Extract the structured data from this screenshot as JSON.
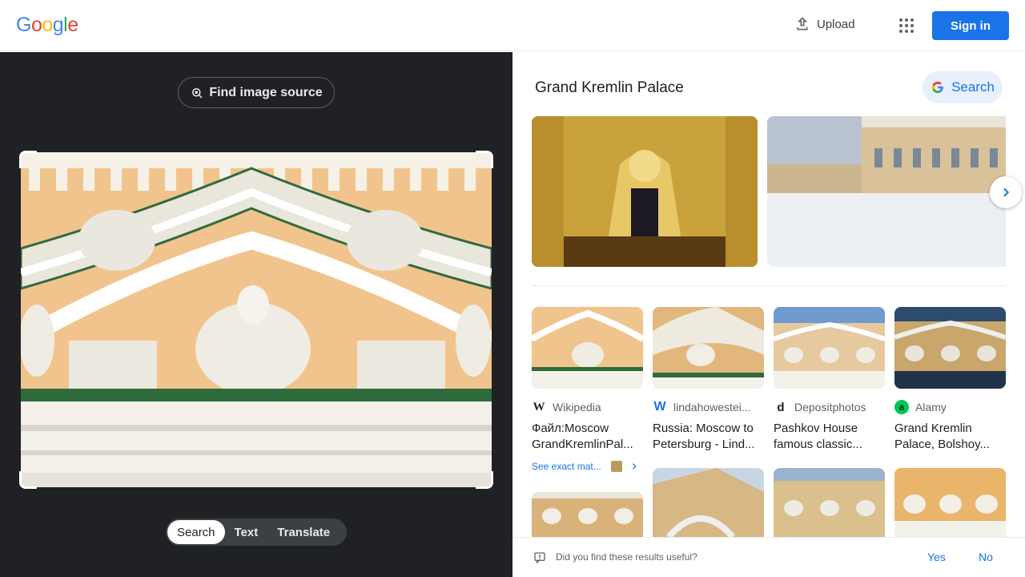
{
  "header": {
    "logo_letters": [
      {
        "ch": "G",
        "color": "#4285f4"
      },
      {
        "ch": "o",
        "color": "#ea4335"
      },
      {
        "ch": "o",
        "color": "#fbbc05"
      },
      {
        "ch": "g",
        "color": "#4285f4"
      },
      {
        "ch": "l",
        "color": "#34a853"
      },
      {
        "ch": "e",
        "color": "#ea4335"
      }
    ],
    "upload_label": "Upload",
    "signin_label": "Sign in"
  },
  "left_panel": {
    "find_source_label": "Find image source",
    "modes": [
      "Search",
      "Text",
      "Translate"
    ],
    "active_mode": "Search"
  },
  "right_panel": {
    "entity_title": "Grand Kremlin Palace",
    "search_button_label": "Search",
    "results": [
      {
        "source": "Wikipedia",
        "source_icon": "W",
        "title": "Файл:Moscow GrandKremlinPal...",
        "exact_match_label": "See exact mat..."
      },
      {
        "source": "lindahowestei...",
        "source_icon": "W",
        "title": "Russia: Moscow to Petersburg - Lind..."
      },
      {
        "source": "Depositphotos",
        "source_icon": "d",
        "title": "Pashkov House famous classic..."
      },
      {
        "source": "Alamy",
        "source_icon": "a",
        "title": "Grand Kremlin Palace, Bolshoy..."
      }
    ],
    "feedback": {
      "question": "Did you find these results useful?",
      "yes": "Yes",
      "no": "No"
    }
  },
  "colors": {
    "accent": "#1a73e8",
    "dark_bg": "#202124"
  }
}
